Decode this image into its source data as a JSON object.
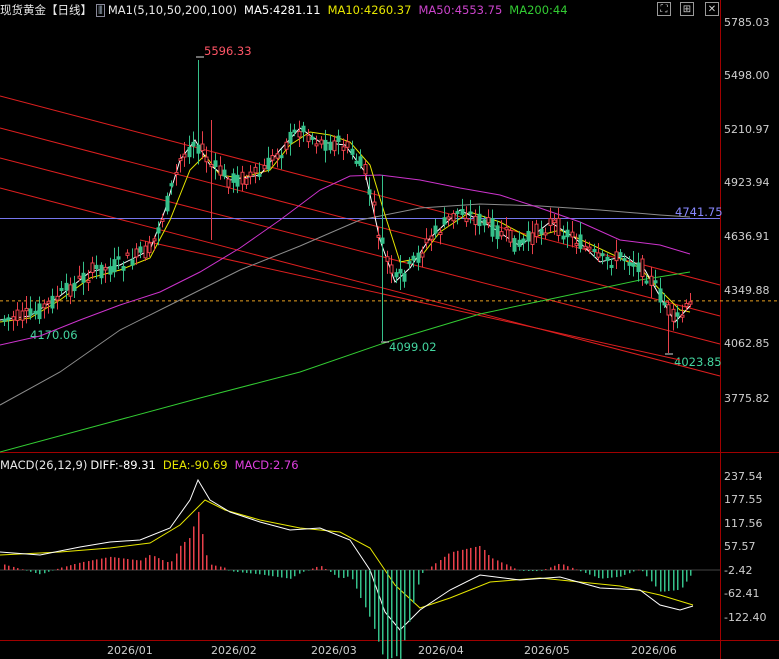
{
  "header": {
    "instrument": "现货黄金",
    "period": "【日线】",
    "indicator": "MA1(5,10,50,200,100)",
    "ma5": "MA5:4281.11",
    "ma10": "MA10:4260.37",
    "ma50": "MA50:4553.75",
    "ma200": "MA200:44"
  },
  "macd_header": {
    "label": "MACD(26,12,9)",
    "diff": "DIFF:-89.31",
    "dea": "DEA:-90.69",
    "macd": "MACD:2.76"
  },
  "toolbar": {
    "icons": [
      "fullscreen-icon",
      "layout-icon",
      "close-icon"
    ]
  },
  "colors": {
    "up": "#e8404a",
    "down": "#35c08a",
    "ma5": "#ffffff",
    "ma10": "#e6e600",
    "ma50": "#cc33cc",
    "ma200": "#33cc33",
    "ma100": "#8c8c8c",
    "channel": "#dd1f1f",
    "hline": "#7777ee",
    "dea": "#e6e600",
    "diff": "#ffffff"
  },
  "chart_data": [
    {
      "type": "candlestick",
      "title": "现货黄金 日线",
      "y_ticks": [
        "5785.03",
        "5498.00",
        "5210.97",
        "4923.94",
        "4636.91",
        "4349.88",
        "4062.85",
        "3775.82"
      ],
      "ylim": [
        3480,
        5830
      ],
      "x_ticks": [
        "2026/01",
        "2026/02",
        "2026/03",
        "2026/04",
        "2026/05",
        "2026/06"
      ],
      "annotations": [
        {
          "label": "5596.33",
          "value": 5596.33,
          "kind": "high"
        },
        {
          "label": "4170.06",
          "value": 4170.06,
          "kind": "low"
        },
        {
          "label": "4099.02",
          "value": 4099.02,
          "kind": "low"
        },
        {
          "label": "4023.85",
          "value": 4023.85,
          "kind": "low"
        },
        {
          "label": "4741.75",
          "value": 4741.75,
          "kind": "level"
        }
      ],
      "current_price": 4295,
      "series": [
        {
          "name": "MA5",
          "value": 4281.11
        },
        {
          "name": "MA10",
          "value": 4260.37
        },
        {
          "name": "MA50",
          "value": 4553.75
        }
      ]
    },
    {
      "type": "macd",
      "title": "MACD(26,12,9)",
      "y_ticks": [
        "237.54",
        "177.55",
        "117.56",
        "57.57",
        "-2.42",
        "-62.41",
        "-122.40"
      ],
      "ylim": [
        -150,
        260
      ],
      "diff": -89.31,
      "dea": -90.69,
      "macd": 2.76
    }
  ]
}
